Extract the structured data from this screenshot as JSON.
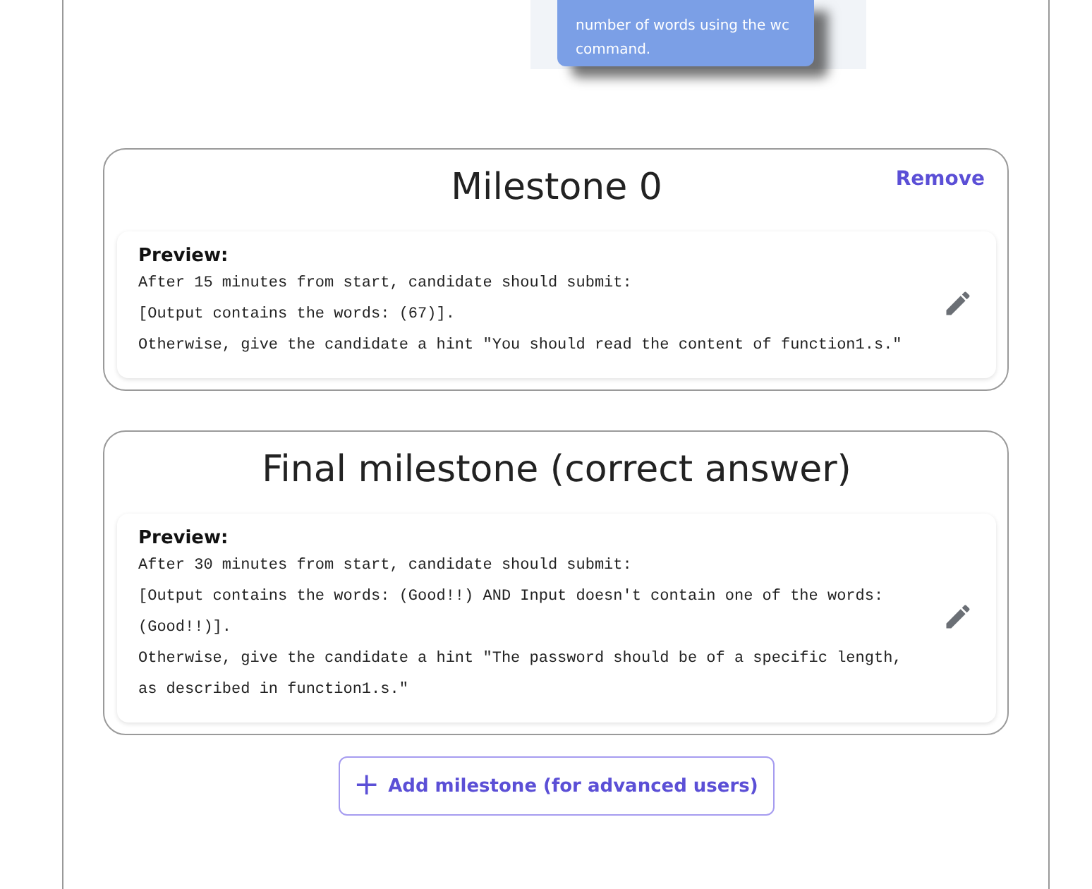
{
  "tooltip": {
    "text": "number of words using the wc command."
  },
  "milestones": [
    {
      "title": "Milestone 0",
      "remove": "Remove",
      "preview_label": "Preview:",
      "lines": [
        "After 15 minutes from start, candidate should submit:",
        "[Output contains the words: (67)].",
        "Otherwise, give the candidate a hint \"You should read the content of function1.s.\""
      ]
    },
    {
      "title": "Final milestone (correct answer)",
      "preview_label": "Preview:",
      "lines": [
        "After 30 minutes from start, candidate should submit:",
        "[Output contains the words: (Good!!) AND Input doesn't contain one of the words: (Good!!)].",
        "Otherwise, give the candidate a hint \"The password should be of a specific length, as described in function1.s.\""
      ]
    }
  ],
  "add_button": {
    "icon": "+",
    "label": "Add milestone (for advanced users)"
  }
}
